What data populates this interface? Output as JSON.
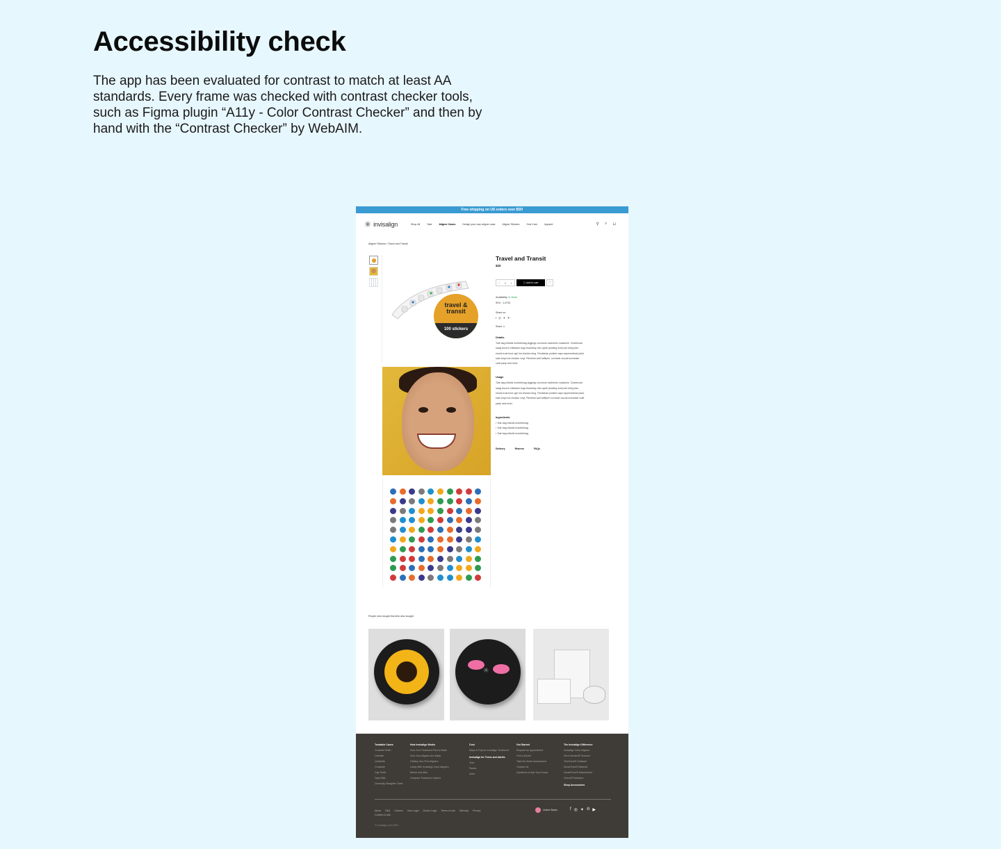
{
  "page": {
    "heading": "Accessibility check",
    "intro": "The app has been evaluated for contrast to match at least AA standards. Every frame was checked with contrast checker tools, such as Figma plugin “A11y - Color Contrast Checker” and then by hand with the “Contrast Checker” by WebAIM."
  },
  "site": {
    "promo": "Free shipping on US orders over $50!",
    "logo": "invisalign",
    "nav": [
      "Shop All",
      "Sale",
      "Aligner Cases",
      "Design your own aligner case",
      "Aligner Stickers",
      "Oral Care",
      "Apparel"
    ],
    "active_nav": "Aligner Cases",
    "icons": {
      "account": "user-icon",
      "search": "search-icon",
      "cart": "bag-icon"
    },
    "breadcrumb": "Aligner Stickers / Travel and Transit"
  },
  "product": {
    "title": "Travel and Transit",
    "price": "$20",
    "quantity": "1",
    "add_to_cart": "Add to cart",
    "availability_label": "Availability:",
    "availability_value": "In Stock",
    "sku": "SKU : 1-4734",
    "share_on": "Share on:",
    "share_more": "Share",
    "badge_line1": "travel &",
    "badge_line2": "transit",
    "badge_bottom": "100 stickers",
    "details_title": "Details",
    "details_text": "Tote bag mlkshk humblebrag leggings normcore authentic mustache. Chartreuse swag brunch chillwave kogi chambray chic synth jianbing wolf pork belly jean shorts trust fund ugh hot chicken blog. Flexitarian pickled vape asymmetrical plaid kale chips hot chicken vinyl. Pitchfork wolf keffiyeh, cornhole crucial scenester craft party next level.",
    "usage_title": "Usage",
    "usage_text": "Tote bag mlkshk humblebrag leggings normcore authentic mustache. Chartreuse swag brunch chillwave kogi chambray chic synth jianbing wolf pork belly jean shorts trust fund ugh hot chicken blog. Flexitarian pickled vape asymmetrical plaid kale chips hot chicken vinyl. Pitchfork wolf keffiyeh cornhole crucial scenester craft party next level.",
    "ingredients_title": "Ingredients",
    "ingredients": [
      "• Tote bag mlkshk humblebrag",
      "• Tote bag mlkshk humblebrag",
      "• Tote bag mlkshk humblebrag"
    ],
    "tabs": [
      "Delivery",
      "Returns",
      "FAQs"
    ]
  },
  "also_bought": "People who bought this item also bought",
  "footer": {
    "columns": [
      {
        "title": "Treatable Cases",
        "links": [
          "Crowded Teeth",
          "Overbite",
          "Underbite",
          "Crossbite",
          "Gap Teeth",
          "Open Bite",
          "Generally Straighter Teeth"
        ]
      },
      {
        "title": "How Invisalign Works",
        "links": [
          "How Your Treatment Plan is Made",
          "How Your Aligners Are Made",
          "Getting Your First Aligners",
          "Living With Invisalign Clear Aligners",
          "Before and After",
          "Compare Treatment Options"
        ]
      },
      {
        "title": "Cost",
        "links": [
          "Ways to Pay for Invisalign Treatment"
        ],
        "sub_title": "Invisalign for Teens and Adults",
        "sub_links": [
          "Teen",
          "Parent",
          "Adult"
        ]
      },
      {
        "title": "Get Started",
        "links": [
          "Request an Appointment",
          "Find a Doctor",
          "Take the Smile Assessment",
          "Contact Us",
          "Questions to Ask Your Doctor"
        ]
      },
      {
        "title": "The Invisalign Difference",
        "links": [
          "Invisalign Clear Aligners",
          "iTero Element® Scanner",
          "ClinCheck® Software",
          "SmartTrack® Material",
          "SmartForce® Attachments",
          "Vivera® Retainers"
        ],
        "extra": "Shop Accessories"
      }
    ],
    "bottom_links": [
      "About",
      "FAQ",
      "Careers",
      "User Login",
      "Doctor Login",
      "Terms of Use",
      "Sitemap",
      "Privacy",
      "Cookies & Ads"
    ],
    "region": "United States",
    "social": [
      "facebook-icon",
      "instagram-icon",
      "twitter-icon",
      "pinterest-icon",
      "youtube-icon"
    ],
    "copyright": "© invisalign.com 2021"
  },
  "colors": {
    "background": "#e7f7fe",
    "promo_bar": "#3a9bd2",
    "footer": "#3f3c38",
    "in_stock": "#2a9d4b",
    "badge": "#e6a129"
  }
}
